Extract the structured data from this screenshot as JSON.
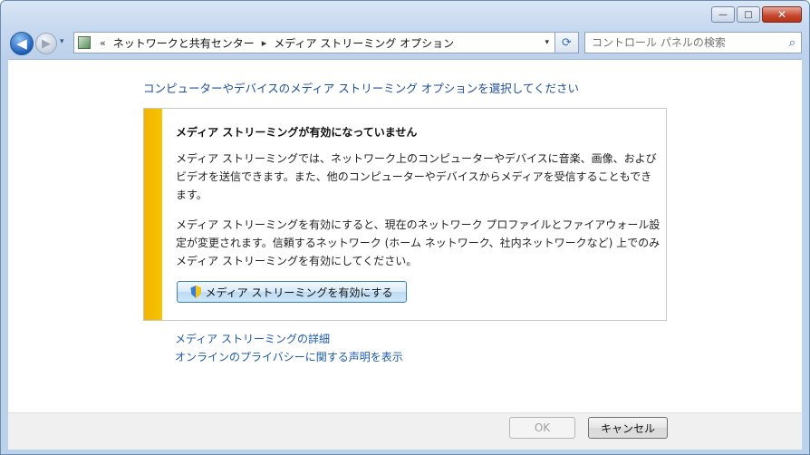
{
  "window": {
    "minimize_label": "—",
    "maximize_label": "□",
    "close_label": "✕"
  },
  "nav": {
    "back_glyph": "◀",
    "forward_glyph": "▶",
    "history_glyph": "▾",
    "breadcrumb": [
      "ネットワークと共有センター",
      "メディア ストリーミング オプション"
    ],
    "overflow_glyph": "«",
    "separator_glyph": "▸",
    "dropdown_glyph": "▾",
    "refresh_glyph": "⟳"
  },
  "search": {
    "placeholder": "コントロール パネルの検索",
    "icon": "search-icon"
  },
  "main": {
    "heading": "コンピューターやデバイスのメディア ストリーミング オプションを選択してください",
    "panel": {
      "title": "メディア ストリーミングが有効になっていません",
      "para1": "メディア ストリーミングでは、ネットワーク上のコンピューターやデバイスに音楽、画像、およびビデオを送信できます。また、他のコンピューターやデバイスからメディアを受信することもできます。",
      "para2": "メディア ストリーミングを有効にすると、現在のネットワーク プロファイルとファイアウォール設定が変更されます。信頼するネットワーク (ホーム ネットワーク、社内ネットワークなど) 上でのみメディア ストリーミングを有効にしてください。",
      "enable_button": "メディア ストリーミングを有効にする"
    },
    "links": [
      "メディア ストリーミングの詳細",
      "オンラインのプライバシーに関する声明を表示"
    ]
  },
  "footer": {
    "ok": "OK",
    "cancel": "キャンセル"
  },
  "colors": {
    "accent_link": "#1e5aa8",
    "warning_bar": "#f2b400"
  }
}
